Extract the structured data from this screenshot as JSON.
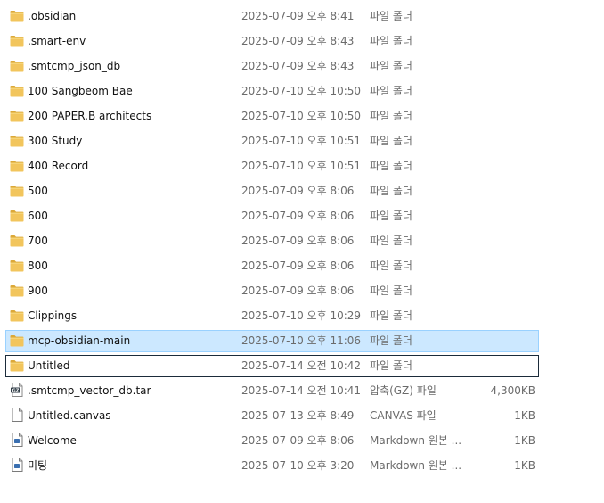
{
  "colors": {
    "folder_yellow": "#f2c55c",
    "folder_dark": "#dba838",
    "selection_border": "#1b2b3a",
    "muted_text": "#6b6b6b"
  },
  "files": [
    {
      "name": ".obsidian",
      "date": "2025-07-09 오후 8:41",
      "type": "파일 폴더",
      "size": "",
      "icon": "folder-icon",
      "state": ""
    },
    {
      "name": ".smart-env",
      "date": "2025-07-09 오후 8:43",
      "type": "파일 폴더",
      "size": "",
      "icon": "folder-icon",
      "state": ""
    },
    {
      "name": ".smtcmp_json_db",
      "date": "2025-07-09 오후 8:43",
      "type": "파일 폴더",
      "size": "",
      "icon": "folder-icon",
      "state": ""
    },
    {
      "name": "100 Sangbeom Bae",
      "date": "2025-07-10 오후 10:50",
      "type": "파일 폴더",
      "size": "",
      "icon": "folder-icon",
      "state": ""
    },
    {
      "name": "200 PAPER.B architects",
      "date": "2025-07-10 오후 10:50",
      "type": "파일 폴더",
      "size": "",
      "icon": "folder-icon",
      "state": ""
    },
    {
      "name": "300 Study",
      "date": "2025-07-10 오후 10:51",
      "type": "파일 폴더",
      "size": "",
      "icon": "folder-icon",
      "state": ""
    },
    {
      "name": "400 Record",
      "date": "2025-07-10 오후 10:51",
      "type": "파일 폴더",
      "size": "",
      "icon": "folder-icon",
      "state": ""
    },
    {
      "name": "500",
      "date": "2025-07-09 오후 8:06",
      "type": "파일 폴더",
      "size": "",
      "icon": "folder-icon",
      "state": ""
    },
    {
      "name": "600",
      "date": "2025-07-09 오후 8:06",
      "type": "파일 폴더",
      "size": "",
      "icon": "folder-icon",
      "state": ""
    },
    {
      "name": "700",
      "date": "2025-07-09 오후 8:06",
      "type": "파일 폴더",
      "size": "",
      "icon": "folder-icon",
      "state": ""
    },
    {
      "name": "800",
      "date": "2025-07-09 오후 8:06",
      "type": "파일 폴더",
      "size": "",
      "icon": "folder-icon",
      "state": ""
    },
    {
      "name": "900",
      "date": "2025-07-09 오후 8:06",
      "type": "파일 폴더",
      "size": "",
      "icon": "folder-icon",
      "state": ""
    },
    {
      "name": "Clippings",
      "date": "2025-07-10 오후 10:29",
      "type": "파일 폴더",
      "size": "",
      "icon": "folder-icon",
      "state": ""
    },
    {
      "name": "mcp-obsidian-main",
      "date": "2025-07-10 오후 11:06",
      "type": "파일 폴더",
      "size": "",
      "icon": "folder-icon",
      "state": "selected"
    },
    {
      "name": "Untitled",
      "date": "2025-07-14 오전 10:42",
      "type": "파일 폴더",
      "size": "",
      "icon": "folder-icon",
      "state": "hover"
    },
    {
      "name": ".smtcmp_vector_db.tar",
      "date": "2025-07-14 오전 10:41",
      "type": "압축(GZ) 파일",
      "size": "4,300KB",
      "icon": "gz-archive-icon",
      "state": ""
    },
    {
      "name": "Untitled.canvas",
      "date": "2025-07-13 오후 8:49",
      "type": "CANVAS 파일",
      "size": "1KB",
      "icon": "blank-file-icon",
      "state": ""
    },
    {
      "name": "Welcome",
      "date": "2025-07-09 오후 8:06",
      "type": "Markdown 원본 ...",
      "size": "1KB",
      "icon": "markdown-file-icon",
      "state": ""
    },
    {
      "name": "미팅",
      "date": "2025-07-10 오후 3:20",
      "type": "Markdown 원본 ...",
      "size": "1KB",
      "icon": "markdown-file-icon",
      "state": ""
    }
  ]
}
